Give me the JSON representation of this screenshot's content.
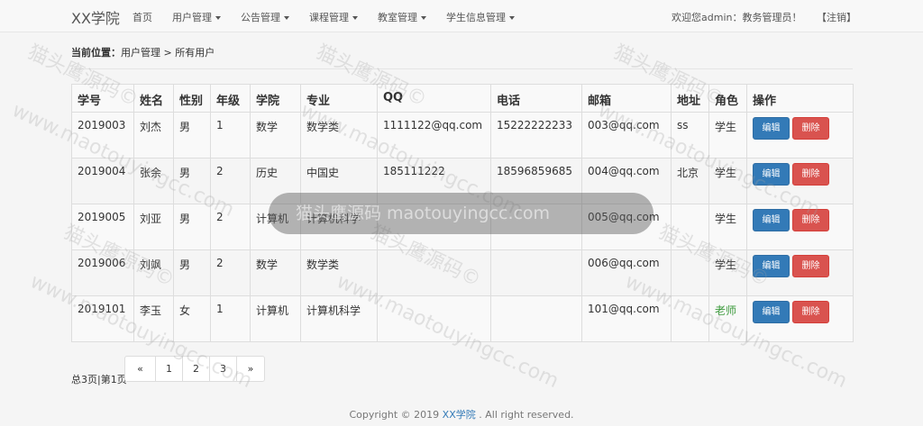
{
  "navbar": {
    "brand": "XX学院",
    "items": [
      {
        "label": "首页",
        "dropdown": false
      },
      {
        "label": "用户管理",
        "dropdown": true
      },
      {
        "label": "公告管理",
        "dropdown": true
      },
      {
        "label": "课程管理",
        "dropdown": true
      },
      {
        "label": "教室管理",
        "dropdown": true
      },
      {
        "label": "学生信息管理",
        "dropdown": true
      }
    ],
    "welcome": "欢迎您admin：教务管理员！",
    "logout": "【注销】"
  },
  "breadcrumb": {
    "prefix": "当前位置：",
    "path": "用户管理 > 所有用户"
  },
  "table": {
    "columns": [
      "学号",
      "姓名",
      "性别",
      "年级",
      "学院",
      "专业",
      "QQ",
      "电话",
      "邮箱",
      "地址",
      "角色",
      "操作"
    ],
    "rows": [
      [
        "2019003",
        "刘杰",
        "男",
        "1",
        "数学",
        "数学类",
        "1111122@qq.com",
        "15222222233",
        "003@qq.com",
        "ss",
        "学生"
      ],
      [
        "2019004",
        "张余",
        "男",
        "2",
        "历史",
        "中国史",
        "185111222",
        "18596859685",
        "004@qq.com",
        "北京",
        "学生"
      ],
      [
        "2019005",
        "刘亚",
        "男",
        "2",
        "计算机",
        "计算机科学",
        "",
        "",
        "005@qq.com",
        "",
        "学生"
      ],
      [
        "2019006",
        "刘飒",
        "男",
        "2",
        "数学",
        "数学类",
        "",
        "",
        "006@qq.com",
        "",
        "学生"
      ],
      [
        "2019101",
        "李玉",
        "女",
        "1",
        "计算机",
        "计算机科学",
        "",
        "",
        "101@qq.com",
        "",
        "老师"
      ]
    ],
    "edit_label": "编辑",
    "delete_label": "删除"
  },
  "pagination": {
    "info": "总3页|第1页",
    "prev": "«",
    "pages": [
      "1",
      "2",
      "3"
    ],
    "next": "»"
  },
  "footer": {
    "prefix": "Copyright © 2019 ",
    "school": "XX学院",
    "suffix": " . All right reserved."
  },
  "overlay": {
    "text": "猫头鹰源码 maotouyingcc.com"
  },
  "watermark": {
    "text": "www.maotouyingcc.com",
    "cn": "猫头鹰源码©"
  },
  "colors": {
    "primary": "#337ab7",
    "danger": "#d9534f",
    "teacher": "#3c9a3c"
  }
}
